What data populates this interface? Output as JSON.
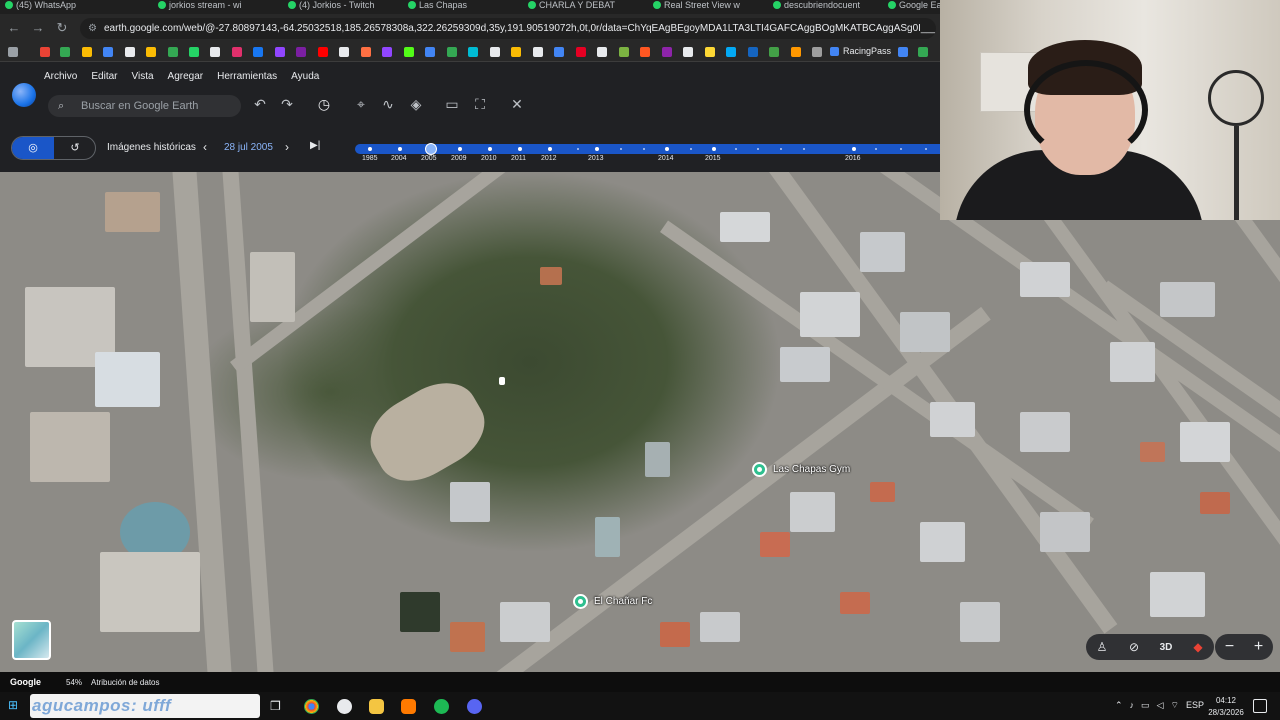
{
  "browser": {
    "tabs": [
      "(45) WhatsApp",
      "jorkios stream - wi",
      "(4) Jorkios - Twitch",
      "Las Chapas",
      "CHARLA Y DEBATE",
      "Real Street View w",
      "descubriendocuent",
      "Google Earth"
    ],
    "url": "earth.google.com/web/@-27.80897143,-64.25032518,185.26578308a,322.26259309d,35y,191.90519072h,0t,0r/data=ChYqEAgBEgoyMDA1LTA3LTI4GAFCAggBOgMKATBCAggASg0I__________ARAA",
    "bookmark_racing": "RacingPass"
  },
  "earth": {
    "menu": [
      "Archivo",
      "Editar",
      "Vista",
      "Agregar",
      "Herramientas",
      "Ayuda"
    ],
    "search_placeholder": "Buscar en Google Earth",
    "historical_label": "Imágenes históricas",
    "date": "28 jul 2005",
    "timeline_years": [
      "1985",
      "2004",
      "2005",
      "2009",
      "2010",
      "2011",
      "2012",
      "2013",
      "2014",
      "2015",
      "2016"
    ],
    "selected_year": "2005"
  },
  "map": {
    "pois": [
      {
        "name": "Las Chapas Gym"
      },
      {
        "name": "El Chañar Fc"
      }
    ],
    "controls": {
      "three_d": "3D"
    }
  },
  "statusbar": {
    "google": "Google",
    "loading": "54%",
    "attribution": "Atribución de datos"
  },
  "taskbar": {
    "search_overlay": "agucampos: ufff",
    "lang": "ESP",
    "time": "04:12",
    "date": "28/3/2026"
  },
  "colors": {
    "accent": "#8ab4f8",
    "timeline": "#1a56c8",
    "poi": "#2fbf8f"
  }
}
